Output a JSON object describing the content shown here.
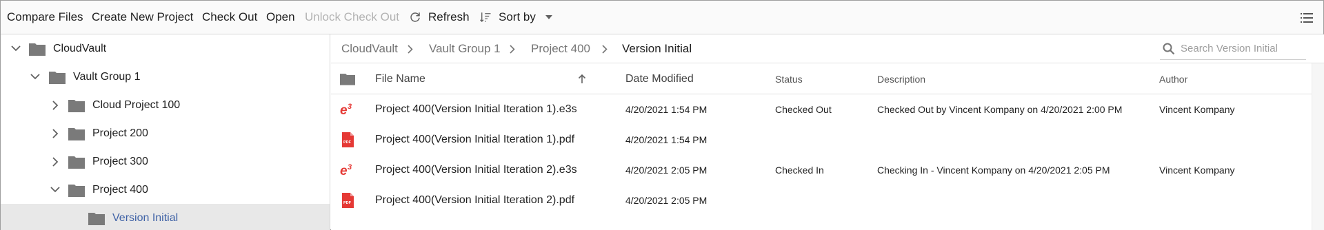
{
  "toolbar": {
    "compare_files": "Compare Files",
    "create_new_project": "Create New Project",
    "check_out": "Check Out",
    "open": "Open",
    "unlock_check_out": "Unlock Check Out",
    "refresh": "Refresh",
    "sort_by": "Sort by",
    "disabled_items": [
      "Unlock Check Out"
    ],
    "icons": [
      "refresh-icon",
      "sort-icon",
      "dropdown-caret-icon",
      "list-menu-icon"
    ]
  },
  "tree": {
    "items": [
      {
        "label": "CloudVault",
        "level": 0,
        "expanded": true
      },
      {
        "label": "Vault Group 1",
        "level": 1,
        "expanded": true
      },
      {
        "label": "Cloud Project 100",
        "level": 2,
        "expanded": false
      },
      {
        "label": "Project 200",
        "level": 2,
        "expanded": false
      },
      {
        "label": "Project 300",
        "level": 2,
        "expanded": false
      },
      {
        "label": "Project 400",
        "level": 2,
        "expanded": true
      },
      {
        "label": "Version Initial",
        "level": 3,
        "selected": true
      }
    ]
  },
  "breadcrumb": {
    "items": [
      "CloudVault",
      "Vault Group 1",
      "Project 400",
      "Version Initial"
    ]
  },
  "search": {
    "placeholder": "Search Version Initial",
    "value": ""
  },
  "table": {
    "columns": {
      "file_name": "File Name",
      "date_modified": "Date Modified",
      "status": "Status",
      "description": "Description",
      "author": "Author"
    },
    "sort": {
      "column": "File Name",
      "direction": "ascending"
    },
    "rows": [
      {
        "type": "e3s",
        "file_name": "Project 400(Version Initial Iteration 1).e3s",
        "date_modified": "4/20/2021 1:54 PM",
        "status": "Checked Out",
        "description": "Checked Out by Vincent Kompany on 4/20/2021 2:00 PM",
        "author": "Vincent Kompany"
      },
      {
        "type": "pdf",
        "file_name": "Project 400(Version Initial Iteration 1).pdf",
        "date_modified": "4/20/2021 1:54 PM",
        "status": "",
        "description": "",
        "author": ""
      },
      {
        "type": "e3s",
        "file_name": "Project 400(Version Initial Iteration 2).e3s",
        "date_modified": "4/20/2021 2:05 PM",
        "status": "Checked In",
        "description": "Checking In - Vincent Kompany on 4/20/2021 2:05 PM",
        "author": "Vincent Kompany"
      },
      {
        "type": "pdf",
        "file_name": "Project 400(Version Initial Iteration 2).pdf",
        "date_modified": "4/20/2021 2:05 PM",
        "status": "",
        "description": "",
        "author": ""
      }
    ]
  },
  "colors": {
    "folder": "#7a7a7a",
    "selected_text": "#3f62a6",
    "selected_bg": "#e8e8e8",
    "file_icon_red": "#e53935",
    "disabled_text": "#b3b3b3"
  }
}
